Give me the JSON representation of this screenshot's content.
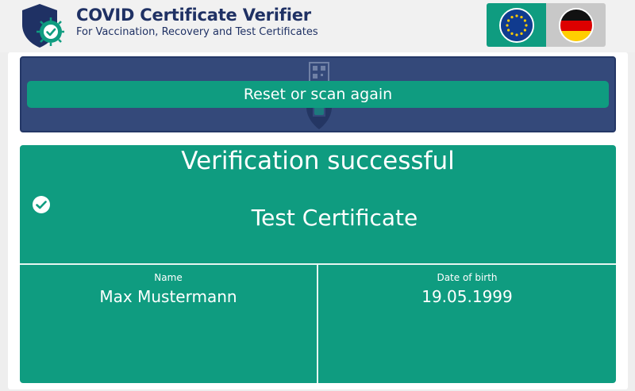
{
  "header": {
    "title": "COVID Certificate Verifier",
    "subtitle": "For Vaccination, Recovery and Test Certificates"
  },
  "icons": {
    "logo": "shield-check-virus-icon",
    "scanner": "qr-phone-scan-icon",
    "success": "check-circle-icon"
  },
  "colors": {
    "primary_green": "#0f9c80",
    "navy": "#1f3164",
    "scanner_bg": "#34497a"
  },
  "scanner": {
    "reset_label": "Reset or scan again"
  },
  "result": {
    "status": "Verification successful",
    "certificate_type": "Test Certificate",
    "fields": {
      "name": {
        "label": "Name",
        "value": "Max Mustermann"
      },
      "dob": {
        "label": "Date of birth",
        "value": "19.05.1999"
      }
    }
  }
}
